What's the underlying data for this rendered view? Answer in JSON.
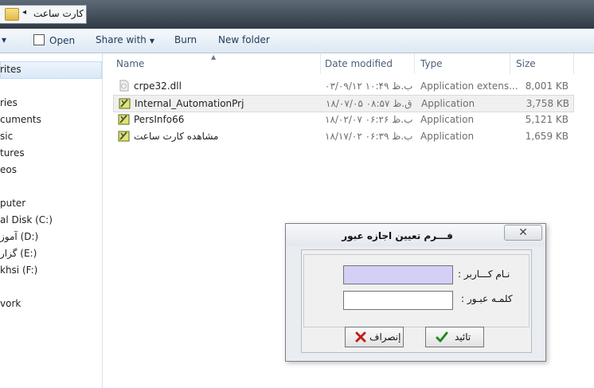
{
  "address": {
    "crumb": "كارت ساعت"
  },
  "toolbar": {
    "organize_arrow": "▾",
    "open_label": "Open",
    "share_label": "Share with",
    "burn_label": "Burn",
    "new_folder_label": "New folder"
  },
  "nav": {
    "items": [
      "rites",
      "ries",
      "cuments",
      "sic",
      "tures",
      "eos",
      "puter",
      "al Disk (C:)",
      "آموز (D:)",
      "گزار (E:)",
      "khsi (F:)",
      "vork"
    ]
  },
  "columns": {
    "name": "Name",
    "date": "Date modified",
    "type": "Type",
    "size": "Size"
  },
  "files": [
    {
      "name": "crpe32.dll",
      "date": "۰۳/۰۹/۱۲ ب.ظ ۱۰:۴۹",
      "type": "Application extens...",
      "size": "8,001 KB",
      "icon": "dll-icon"
    },
    {
      "name": "Internal_AutomationPrj",
      "date": "۱۸/۰۷/۰۵ ق.ظ ۰۸:۵۷",
      "type": "Application",
      "size": "3,758 KB",
      "icon": "app-icon"
    },
    {
      "name": "PersInfo66",
      "date": "۱۸/۰۲/۰۷ ب.ظ ۰۶:۲۶",
      "type": "Application",
      "size": "5,121 KB",
      "icon": "app-icon"
    },
    {
      "name": "مشاهده كارت ساعت",
      "date": "۱۸/۱۷/۰۲ ب.ظ ۰۶:۳۹",
      "type": "Application",
      "size": "1,659 KB",
      "icon": "app-icon"
    }
  ],
  "dialog": {
    "title": "فـــرم تعيين اجازه عبور",
    "close_glyph": "✕",
    "username_label": "نـام كـــاربر :",
    "password_label": "كلمـه عبـور :",
    "username_value": "",
    "password_value": "",
    "ok_label": "تائيد",
    "cancel_label": "إنصراف",
    "colors": {
      "username_bg": "#d4d0f5",
      "password_bg": "#ffffff"
    }
  }
}
